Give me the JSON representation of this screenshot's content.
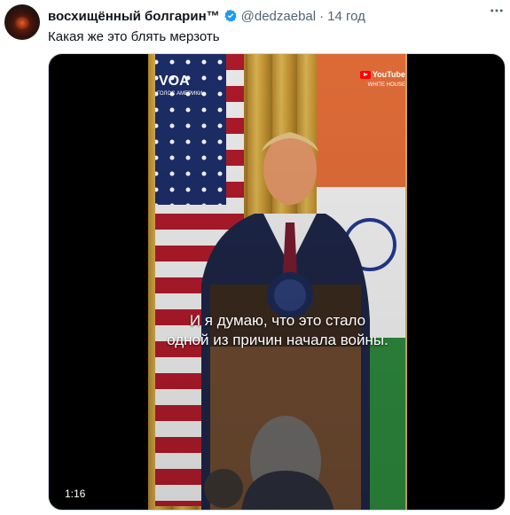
{
  "tweet": {
    "author_name": "восхищённый болгарин™",
    "handle": "@dedzaebal",
    "separator": "·",
    "time": "14 год",
    "text": "Какая же это блять мерзоть",
    "more_icon": "more-horizontal-icon",
    "verified_icon": "verified-badge-icon",
    "verified_color": "#1d9bf0"
  },
  "video": {
    "channel_logo": "VOA",
    "channel_sub": "ГОЛОС АМЕРИКИ",
    "youtube_label": "YouTube",
    "source_label": "WHITE HOUSE",
    "subtitle_line1": "И я думаю, что это стало",
    "subtitle_line2": "одной из причин начала войны.",
    "duration": "1:16"
  }
}
